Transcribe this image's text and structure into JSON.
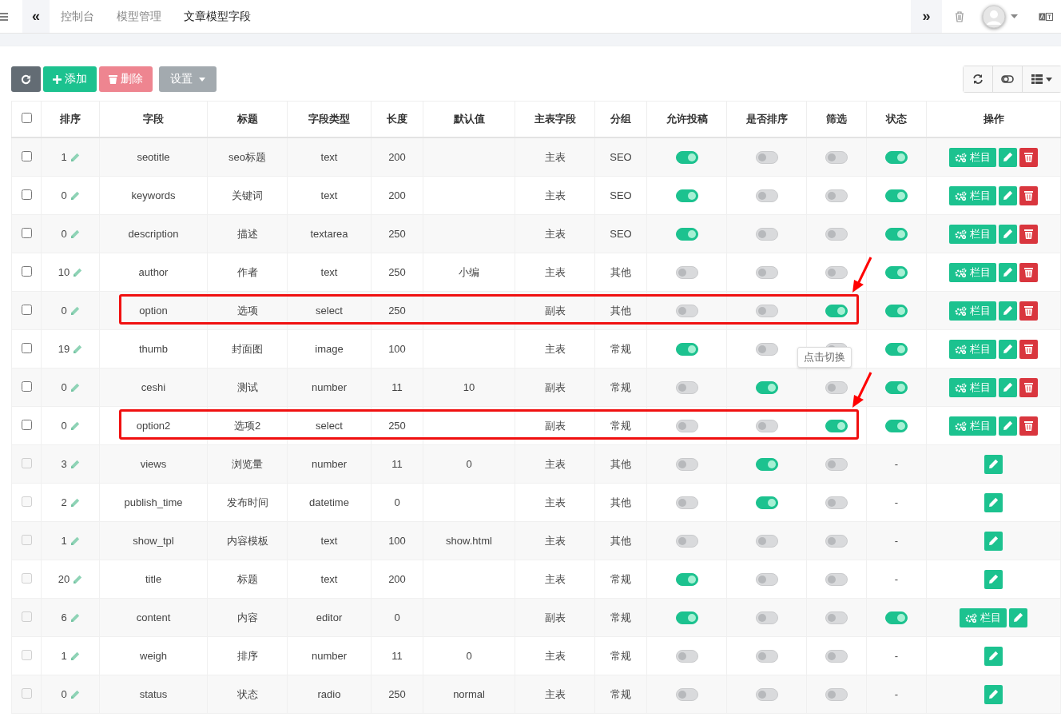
{
  "topbar": {
    "collapse": "«",
    "tabs": [
      {
        "label": "控制台",
        "selected": false
      },
      {
        "label": "模型管理",
        "selected": false
      },
      {
        "label": "文章模型字段",
        "selected": true
      }
    ],
    "expand": "»"
  },
  "toolbar": {
    "buttons": [
      {
        "kind": "refresh"
      },
      {
        "kind": "add",
        "label": "添加"
      },
      {
        "kind": "delete",
        "label": "删除",
        "disabled": true
      },
      {
        "kind": "settings",
        "label": "设置"
      }
    ]
  },
  "table": {
    "columns": [
      "排序",
      "字段",
      "标题",
      "字段类型",
      "长度",
      "默认值",
      "主表字段",
      "分组",
      "允许投稿",
      "是否排序",
      "筛选",
      "状态",
      "操作"
    ],
    "header_checked": false,
    "rows": [
      {
        "checked": false,
        "disabled": false,
        "sort": "1",
        "field": "seotitle",
        "title": "seo标题",
        "type": "text",
        "length": "200",
        "default": "",
        "table": "主表",
        "group": "SEO",
        "contribute": true,
        "sortable": false,
        "filter": false,
        "status": {
          "kind": "toggle",
          "on": true
        },
        "actions": [
          {
            "kind": "columns",
            "label": "栏目"
          },
          {
            "kind": "edit"
          },
          {
            "kind": "delete"
          }
        ]
      },
      {
        "checked": false,
        "disabled": false,
        "sort": "0",
        "field": "keywords",
        "title": "关键词",
        "type": "text",
        "length": "200",
        "default": "",
        "table": "主表",
        "group": "SEO",
        "contribute": true,
        "sortable": false,
        "filter": false,
        "status": {
          "kind": "toggle",
          "on": true
        },
        "actions": [
          {
            "kind": "columns",
            "label": "栏目"
          },
          {
            "kind": "edit"
          },
          {
            "kind": "delete"
          }
        ]
      },
      {
        "checked": false,
        "disabled": false,
        "sort": "0",
        "field": "description",
        "title": "描述",
        "type": "textarea",
        "length": "250",
        "default": "",
        "table": "主表",
        "group": "SEO",
        "contribute": true,
        "sortable": false,
        "filter": false,
        "status": {
          "kind": "toggle",
          "on": true
        },
        "actions": [
          {
            "kind": "columns",
            "label": "栏目"
          },
          {
            "kind": "edit"
          },
          {
            "kind": "delete"
          }
        ]
      },
      {
        "checked": false,
        "disabled": false,
        "sort": "10",
        "field": "author",
        "title": "作者",
        "type": "text",
        "length": "250",
        "default": "小编",
        "table": "主表",
        "group": "其他",
        "contribute": false,
        "sortable": false,
        "filter": false,
        "status": {
          "kind": "toggle",
          "on": true
        },
        "actions": [
          {
            "kind": "columns",
            "label": "栏目"
          },
          {
            "kind": "edit"
          },
          {
            "kind": "delete"
          }
        ]
      },
      {
        "checked": false,
        "disabled": false,
        "sort": "0",
        "field": "option",
        "title": "选项",
        "type": "select",
        "length": "250",
        "default": "",
        "table": "副表",
        "group": "其他",
        "contribute": false,
        "sortable": false,
        "filter": true,
        "highlighted": true,
        "status": {
          "kind": "toggle",
          "on": true
        },
        "actions": [
          {
            "kind": "columns",
            "label": "栏目"
          },
          {
            "kind": "edit"
          },
          {
            "kind": "delete"
          }
        ]
      },
      {
        "checked": false,
        "disabled": false,
        "sort": "19",
        "field": "thumb",
        "title": "封面图",
        "type": "image",
        "length": "100",
        "default": "",
        "table": "主表",
        "group": "常规",
        "contribute": true,
        "sortable": false,
        "filter": false,
        "status": {
          "kind": "toggle",
          "on": true
        },
        "actions": [
          {
            "kind": "columns",
            "label": "栏目"
          },
          {
            "kind": "edit"
          },
          {
            "kind": "delete"
          }
        ]
      },
      {
        "checked": false,
        "disabled": false,
        "sort": "0",
        "field": "ceshi",
        "title": "测试",
        "type": "number",
        "length": "11",
        "default": "10",
        "table": "副表",
        "group": "常规",
        "contribute": false,
        "sortable": true,
        "filter": false,
        "tooltip": "点击切换",
        "status": {
          "kind": "toggle",
          "on": true
        },
        "actions": [
          {
            "kind": "columns",
            "label": "栏目"
          },
          {
            "kind": "edit"
          },
          {
            "kind": "delete"
          }
        ]
      },
      {
        "checked": false,
        "disabled": false,
        "sort": "0",
        "field": "option2",
        "title": "选项2",
        "type": "select",
        "length": "250",
        "default": "",
        "table": "副表",
        "group": "常规",
        "contribute": false,
        "sortable": false,
        "filter": true,
        "highlighted": true,
        "status": {
          "kind": "toggle",
          "on": true
        },
        "actions": [
          {
            "kind": "columns",
            "label": "栏目"
          },
          {
            "kind": "edit"
          },
          {
            "kind": "delete"
          }
        ]
      },
      {
        "checked": false,
        "disabled": true,
        "sort": "3",
        "field": "views",
        "title": "浏览量",
        "type": "number",
        "length": "11",
        "default": "0",
        "table": "主表",
        "group": "其他",
        "contribute": false,
        "sortable": true,
        "filter": false,
        "status": {
          "kind": "text",
          "text": "-"
        },
        "actions": [
          {
            "kind": "edit"
          }
        ]
      },
      {
        "checked": false,
        "disabled": true,
        "sort": "2",
        "field": "publish_time",
        "title": "发布时间",
        "type": "datetime",
        "length": "0",
        "default": "",
        "table": "主表",
        "group": "其他",
        "contribute": false,
        "sortable": true,
        "filter": false,
        "status": {
          "kind": "text",
          "text": "-"
        },
        "actions": [
          {
            "kind": "edit"
          }
        ]
      },
      {
        "checked": false,
        "disabled": true,
        "sort": "1",
        "field": "show_tpl",
        "title": "内容模板",
        "type": "text",
        "length": "100",
        "default": "show.html",
        "table": "主表",
        "group": "其他",
        "contribute": false,
        "sortable": false,
        "filter": false,
        "status": {
          "kind": "text",
          "text": "-"
        },
        "actions": [
          {
            "kind": "edit"
          }
        ]
      },
      {
        "checked": false,
        "disabled": true,
        "sort": "20",
        "field": "title",
        "title": "标题",
        "type": "text",
        "length": "200",
        "default": "",
        "table": "主表",
        "group": "常规",
        "contribute": true,
        "sortable": false,
        "filter": false,
        "status": {
          "kind": "text",
          "text": "-"
        },
        "actions": [
          {
            "kind": "edit"
          }
        ]
      },
      {
        "checked": false,
        "disabled": true,
        "sort": "6",
        "field": "content",
        "title": "内容",
        "type": "editor",
        "length": "0",
        "default": "",
        "table": "副表",
        "group": "常规",
        "contribute": true,
        "sortable": false,
        "filter": false,
        "status": {
          "kind": "toggle",
          "on": true
        },
        "actions": [
          {
            "kind": "columns",
            "label": "栏目"
          },
          {
            "kind": "edit"
          }
        ]
      },
      {
        "checked": false,
        "disabled": true,
        "sort": "1",
        "field": "weigh",
        "title": "排序",
        "type": "number",
        "length": "11",
        "default": "0",
        "table": "主表",
        "group": "常规",
        "contribute": false,
        "sortable": false,
        "filter": false,
        "status": {
          "kind": "text",
          "text": "-"
        },
        "actions": [
          {
            "kind": "edit"
          }
        ]
      },
      {
        "checked": false,
        "disabled": true,
        "sort": "0",
        "field": "status",
        "title": "状态",
        "type": "radio",
        "length": "250",
        "default": "normal",
        "table": "主表",
        "group": "常规",
        "contribute": false,
        "sortable": false,
        "filter": false,
        "status": {
          "kind": "text",
          "text": "-"
        },
        "actions": [
          {
            "kind": "edit"
          }
        ]
      }
    ]
  }
}
